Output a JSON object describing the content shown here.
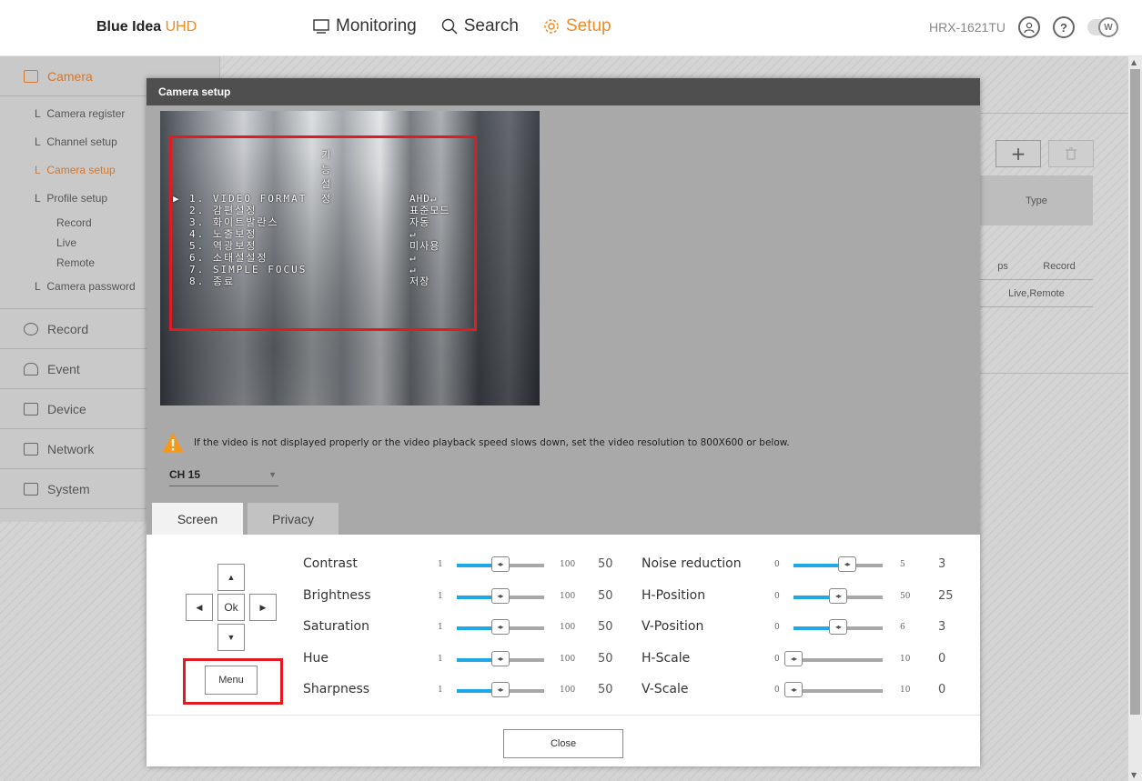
{
  "header": {
    "logo_main": "Blue Idea",
    "logo_accent": "UHD",
    "nav": [
      {
        "label": "Monitoring",
        "icon": "monitor-icon"
      },
      {
        "label": "Search",
        "icon": "search-icon"
      },
      {
        "label": "Setup",
        "icon": "gear-icon"
      }
    ],
    "model": "HRX-1621TU",
    "help": "?",
    "toggle_label": "W"
  },
  "sidebar": {
    "camera": "Camera",
    "camera_items": [
      "Camera register",
      "Channel setup",
      "Camera setup",
      "Profile setup"
    ],
    "profile_items": [
      "Record",
      "Live",
      "Remote"
    ],
    "camera_password": "Camera password",
    "sections": [
      "Record",
      "Event",
      "Device",
      "Network",
      "System"
    ],
    "prefix": "L"
  },
  "background": {
    "add": "+",
    "table_header": "Type",
    "row1": [
      "ps",
      "Record"
    ],
    "row2": [
      "Live,Remote"
    ]
  },
  "modal": {
    "title": "Camera setup",
    "osd": {
      "title": "기능설정",
      "rows": [
        "1. VIDEO FORMAT",
        "2. 감편설정",
        "3. 화이트발란스",
        "4. 노출보정",
        "5. 역광보정",
        "6. 소태설설정",
        "7. SIMPLE FOCUS",
        "8. 종료"
      ],
      "values": [
        "AHD↵",
        "표준모드",
        "자동",
        "↵",
        "미사용",
        "↵",
        "↵",
        "저장"
      ]
    },
    "warning": "If the video is not displayed properly or the video playback speed slows down, set the video resolution to 800X600 or below.",
    "channel": "CH 15",
    "tabs": [
      "Screen",
      "Privacy"
    ],
    "dpad": {
      "up": "▲",
      "down": "▼",
      "left": "◀",
      "right": "▶",
      "ok": "Ok",
      "menu": "Menu"
    },
    "left_sliders": [
      {
        "label": "Contrast",
        "min": "1",
        "max": "100",
        "value": "50"
      },
      {
        "label": "Brightness",
        "min": "1",
        "max": "100",
        "value": "50"
      },
      {
        "label": "Saturation",
        "min": "1",
        "max": "100",
        "value": "50"
      },
      {
        "label": "Hue",
        "min": "1",
        "max": "100",
        "value": "50"
      },
      {
        "label": "Sharpness",
        "min": "1",
        "max": "100",
        "value": "50"
      }
    ],
    "right_sliders": [
      {
        "label": "Noise reduction",
        "min": "0",
        "max": "5",
        "value": "3"
      },
      {
        "label": "H-Position",
        "min": "0",
        "max": "50",
        "value": "25"
      },
      {
        "label": "V-Position",
        "min": "0",
        "max": "6",
        "value": "3"
      },
      {
        "label": "H-Scale",
        "min": "0",
        "max": "10",
        "value": "0"
      },
      {
        "label": "V-Scale",
        "min": "0",
        "max": "10",
        "value": "0"
      }
    ],
    "knob_glyph": "◂▸",
    "close": "Close"
  },
  "colors": {
    "accent": "#f08a24",
    "slider": "#1fa8e8",
    "highlight": "#e01b22"
  }
}
